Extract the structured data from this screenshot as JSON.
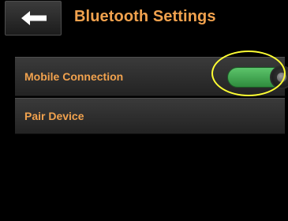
{
  "header": {
    "back_icon": "arrow-left-icon",
    "title": "Bluetooth Settings"
  },
  "settings": [
    {
      "label": "Mobile Connection",
      "toggle": {
        "on": true,
        "on_color": "#4fb45e"
      }
    },
    {
      "label": "Pair Device"
    }
  ],
  "annotation": {
    "highlight_color": "#ffff33",
    "target": "mobile-connection-toggle"
  },
  "colors": {
    "accent_text": "#f1a24e",
    "background": "#000000",
    "row_background": "#2e2e2e"
  }
}
